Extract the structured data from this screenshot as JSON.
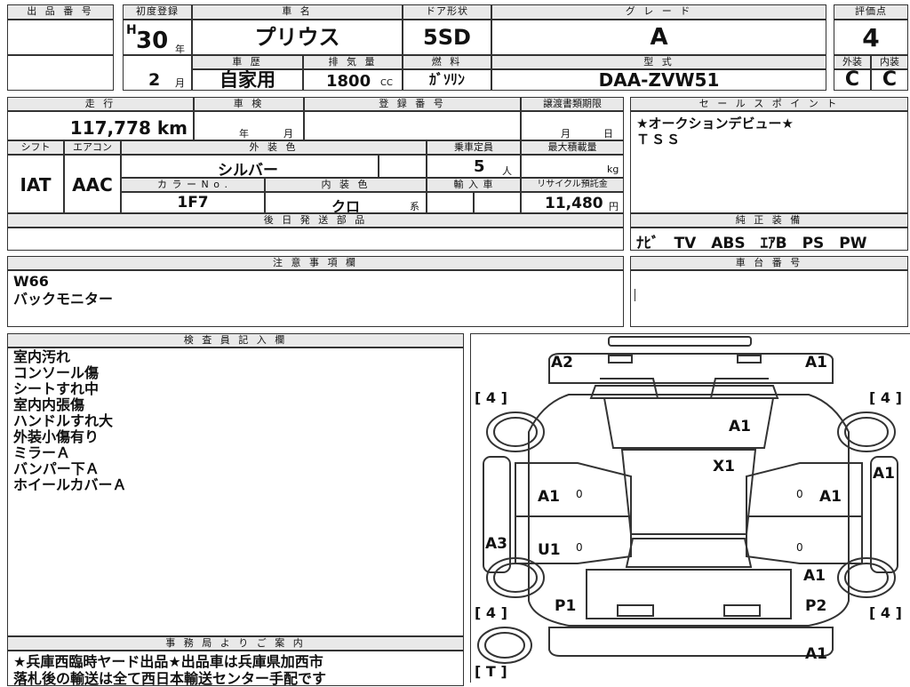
{
  "headers": {
    "lot_no": "出 品 番 号",
    "first_reg": "初度登録",
    "car_name": "車 名",
    "door": "ドア形状",
    "grade": "グ レ ー ド",
    "score": "評価点",
    "history": "車 歴",
    "displacement": "排 気 量",
    "fuel": "燃 料",
    "model": "型 式",
    "exterior": "外装",
    "interior": "内装",
    "mileage": "走 行",
    "inspection": "車 検",
    "reg_no": "登 録 番 号",
    "transfer": "譲渡書類期限",
    "sales_point": "セ ー ル ス ポ イ ン ト",
    "shift": "シフト",
    "aircon": "エアコン",
    "ext_color": "外 装 色",
    "capacity": "乗車定員",
    "max_load": "最大積載量",
    "color_no": "カ ラ ー N o .",
    "int_color": "内 装 色",
    "import": "輸 入 車",
    "recycle": "リサイクル預託金",
    "later_parts": "後 日 発 送 部 品",
    "genuine_equip": "純 正 装 備",
    "caution": "注 意 事 項 欄",
    "chassis_no": "車 台 番 号",
    "inspector": "検 査 員 記 入 欄",
    "office": "事 務 局 よ り ご 案 内"
  },
  "values": {
    "era": "H",
    "year": "30",
    "year_unit": "年",
    "month": "2",
    "month_unit": "月",
    "car_name": "プリウス",
    "door": "5SD",
    "grade": "A",
    "score": "4",
    "history": "自家用",
    "displacement": "1800",
    "cc": "CC",
    "fuel": "ｶﾞｿﾘﾝ",
    "model": "DAA-ZVW51",
    "exterior": "C",
    "interior": "C",
    "mileage": "117,778 km",
    "inspection_year": "年",
    "inspection_month": "月",
    "transfer_month": "月",
    "transfer_day": "日",
    "shift": "IAT",
    "aircon": "AAC",
    "ext_color": "シルバー",
    "capacity": "5",
    "capacity_unit": "人",
    "max_load_unit": "kg",
    "color_no": "1F7",
    "int_color": "クロ",
    "int_color_unit": "系",
    "recycle": "11,480",
    "recycle_unit": "円",
    "equipment": "ﾅﾋﾞ　TV　ABS　ｴｱB　PS　PW"
  },
  "sales_points": [
    "★オークションデビュー★",
    "ＴＳＳ"
  ],
  "caution_notes": [
    "W66",
    "バックモニター"
  ],
  "inspector_notes": [
    "室内汚れ",
    "コンソール傷",
    "シートすれ中",
    "室内内張傷",
    "ハンドルすれ大",
    "外装小傷有り",
    "ミラーＡ",
    "バンパー下Ａ",
    "ホイールカバーＡ"
  ],
  "office_notes": [
    "★兵庫西臨時ヤード出品★出品車は兵庫県加西市",
    "落札後の輸送は全て西日本輸送センター手配です"
  ],
  "diagram": {
    "tires": [
      "[ 4 ]",
      "[ 4 ]",
      "[ 4 ]",
      "[ 4 ]",
      "[ T ]"
    ],
    "marks": {
      "front_left": "A2",
      "front_right": "A1",
      "windshield": "A1",
      "roof": "X1",
      "left_front_door": "A1",
      "right_front_door": "A1",
      "right_fender": "A1",
      "left_rocker": "A3",
      "left_rear_door": "U1",
      "right_rear_qtr": "A1",
      "left_rear": "P1",
      "right_rear": "P2",
      "rear_bumper": "A1"
    },
    "zero": "0"
  }
}
